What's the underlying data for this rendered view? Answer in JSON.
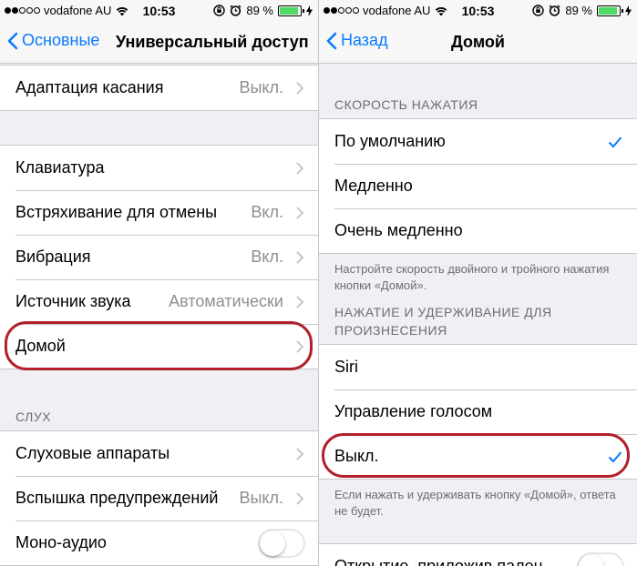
{
  "left": {
    "status": {
      "carrier": "vodafone AU",
      "time": "10:53",
      "battery": "89 %",
      "signal_dots": 5,
      "signal_filled": 2
    },
    "nav": {
      "back_label": "Основные",
      "title": "Универсальный доступ"
    },
    "groups": {
      "g1": [
        {
          "label": "Адаптация касания",
          "value": "Выкл."
        }
      ],
      "g2": [
        {
          "label": "Клавиатура",
          "value": ""
        },
        {
          "label": "Встряхивание для отмены",
          "value": "Вкл."
        },
        {
          "label": "Вибрация",
          "value": "Вкл."
        },
        {
          "label": "Источник звука",
          "value": "Автоматически"
        },
        {
          "label": "Домой",
          "value": ""
        }
      ],
      "hearing_header": "СЛУХ",
      "g3": [
        {
          "label": "Слуховые аппараты",
          "value": ""
        },
        {
          "label": "Вспышка предупреждений",
          "value": "Выкл."
        },
        {
          "label": "Моно-аудио",
          "toggle": false
        }
      ]
    }
  },
  "right": {
    "status": {
      "carrier": "vodafone AU",
      "time": "10:53",
      "battery": "89 %",
      "signal_dots": 5,
      "signal_filled": 2
    },
    "nav": {
      "back_label": "Назад",
      "title": "Домой"
    },
    "speed_header": "СКОРОСТЬ НАЖАТИЯ",
    "speed_options": [
      {
        "label": "По умолчанию",
        "selected": true
      },
      {
        "label": "Медленно",
        "selected": false
      },
      {
        "label": "Очень медленно",
        "selected": false
      }
    ],
    "speed_footer": "Настройте скорость двойного и тройного нажатия кнопки «Домой».",
    "hold_header": "НАЖАТИЕ И УДЕРЖИВАНИЕ ДЛЯ ПРОИЗНЕСЕНИЯ",
    "hold_options": [
      {
        "label": "Siri",
        "selected": false
      },
      {
        "label": "Управление голосом",
        "selected": false
      },
      {
        "label": "Выкл.",
        "selected": true
      }
    ],
    "hold_footer": "Если нажать и удерживать кнопку «Домой», ответа не будет.",
    "partial_row": {
      "label": "Открытие, приложив палец",
      "toggle": false
    }
  },
  "colors": {
    "accent": "#0a7aff",
    "highlight": "#b3202b",
    "battery": "#4cd964"
  }
}
